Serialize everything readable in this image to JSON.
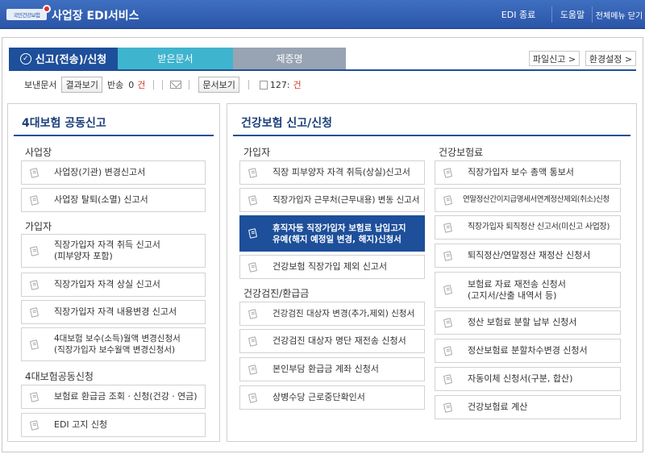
{
  "header": {
    "logo_text": "국민건강보험",
    "title": "사업장 EDI서비스",
    "buttons": [
      "EDI 종료",
      "도움말",
      "전체메뉴 닫기"
    ]
  },
  "tabs": {
    "active": "신고(전송)/신청",
    "received": "받은문서",
    "certificate": "제증명"
  },
  "utility": {
    "file_report": "파일신고 >",
    "settings": "환경설정 >"
  },
  "status": {
    "sent_label": "보낸문서",
    "result_btn": "결과보기",
    "return_label": "반송",
    "return_count": "0",
    "return_unit": "건",
    "doc_btn": "문서보기",
    "print_count": "127:",
    "print_unit": "건"
  },
  "left_panel": {
    "title": "4대보험 공동신고",
    "sections": [
      {
        "title": "사업장",
        "items": [
          "사업장(기관) 변경신고서",
          "사업장 탈퇴(소멸) 신고서"
        ]
      },
      {
        "title": "가입자",
        "items": [
          "직장가입자 자격 취득 신고서\n(피부양자 포함)",
          "직장가입자 자격 상실 신고서",
          "직장가입자 자격 내용변경 신고서",
          "4대보험 보수(소득)월액 변경신청서\n(직장가입자 보수월액 변경신청서)"
        ]
      },
      {
        "title": "4대보험공동신청",
        "items": [
          "보험료 환급금 조회ㆍ신청(건강ㆍ연금)",
          "EDI 고지 신청"
        ]
      }
    ]
  },
  "right_panel": {
    "title": "건강보험 신고/신청",
    "sections": [
      {
        "title": "가입자",
        "items": [
          "직장 피부양자 자격 취득(상실)신고서",
          "직장가입자 근무처(근무내용) 변동 신고서",
          "휴직자등 직장가입자 보험료 납입고지\n유예(해지 예정일 변경, 해지)신청서",
          "건강보험 직장가입 제외 신고서"
        ]
      },
      {
        "title": "건강검진/환급금",
        "items": [
          "건강검진 대상자 변경(추가,제외) 신청서",
          "건강검진 대상자 명단 재전송 신청서",
          "본인부담 환급금 계좌 신청서",
          "상병수당 근로중단확인서"
        ]
      },
      {
        "title": "건강보험료",
        "items": [
          "직장가입자 보수 총액 통보서",
          "연말정산간이지급명세서연계정산제외(취소)신청",
          "직장가입자 퇴직정산 신고서(미신고 사업장)",
          "퇴직정산/연말정산 재정산 신청서",
          "보험료 자료 재전송 신청서\n(고지서/산출 내역서 등)",
          "정산 보험료 분할 납부 신청서",
          "정산보험료 분할차수변경 신청서",
          "자동이체 신청서(구분, 합산)",
          "건강보험료 계산"
        ]
      }
    ]
  }
}
